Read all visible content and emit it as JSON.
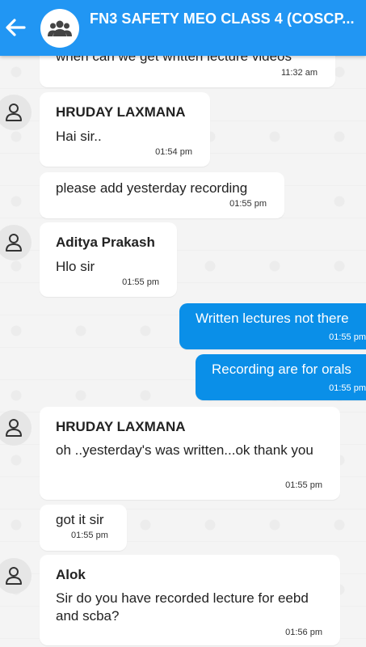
{
  "header": {
    "title": "FN3 SAFETY MEO CLASS 4 (COSCP..."
  },
  "messages": [
    {
      "text": "when can we get written lecture videos",
      "time": "11:32 am"
    },
    {
      "sender": "HRUDAY LAXMANA",
      "text": "Hai sir..",
      "time": "01:54 pm"
    },
    {
      "text": "please add yesterday recording",
      "time": "01:55 pm"
    },
    {
      "sender": "Aditya Prakash",
      "text": "Hlo sir",
      "time": "01:55 pm"
    },
    {
      "text": "Written lectures not there",
      "time": "01:55 pm"
    },
    {
      "text": "Recording are for orals",
      "time": "01:55 pm"
    },
    {
      "sender": "HRUDAY LAXMANA",
      "text": "oh ..yesterday's was written...ok thank you",
      "time": "01:55 pm"
    },
    {
      "text": "got it sir",
      "time": "01:55 pm"
    },
    {
      "sender": "Alok",
      "text": "Sir do you have recorded lecture for eebd and scba?",
      "time": "01:56 pm"
    }
  ],
  "icons": {
    "back": "arrow-left-icon",
    "group": "group-icon",
    "user": "person-icon"
  },
  "colors": {
    "header": "#2196f3",
    "outgoing_bubble": "#0a8fe8",
    "incoming_bubble": "#ffffff"
  }
}
